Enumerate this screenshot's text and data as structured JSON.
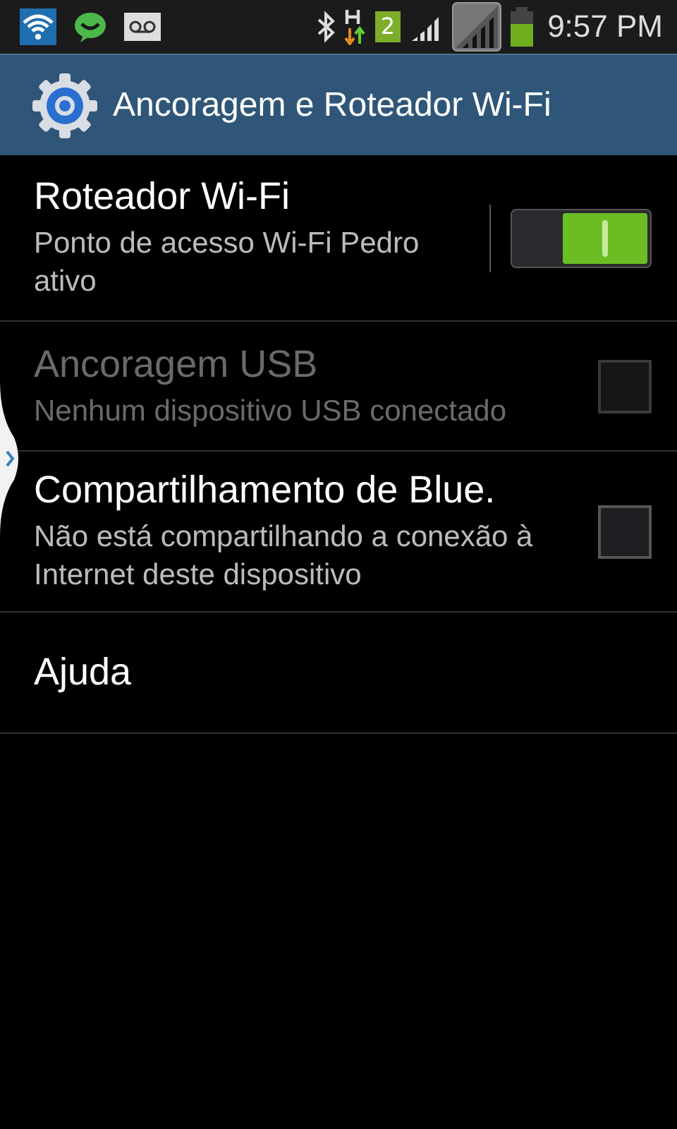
{
  "status_bar": {
    "sim_badge": "2",
    "time": "9:57 PM"
  },
  "title_bar": {
    "title": "Ancoragem e Roteador Wi-Fi"
  },
  "items": [
    {
      "kind": "switch",
      "title": "Roteador Wi-Fi",
      "summary": "Ponto de acesso Wi-Fi Pedro ativo",
      "on": true,
      "disabled": false
    },
    {
      "kind": "checkbox",
      "title": "Ancoragem USB",
      "summary": "Nenhum dispositivo USB conectado",
      "checked": false,
      "disabled": true
    },
    {
      "kind": "checkbox",
      "title": "Compartilhamento de Blue.",
      "summary": "Não está compartilhando a conexão à Internet deste dispositivo",
      "checked": false,
      "disabled": false
    },
    {
      "kind": "plain",
      "title": "Ajuda",
      "disabled": false
    }
  ]
}
